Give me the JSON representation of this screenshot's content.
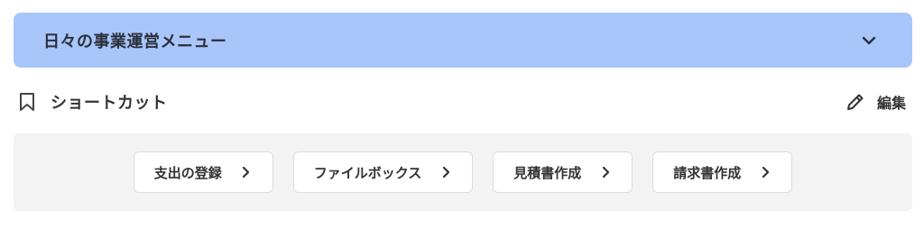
{
  "menu": {
    "title": "日々の事業運営メニュー",
    "toggle_icon": "chevron-down-icon",
    "background_color": "#a8c6fa"
  },
  "shortcuts": {
    "icon": "bookmark-icon",
    "title": "ショートカット",
    "edit": {
      "icon": "pencil-icon",
      "label": "編集"
    },
    "items": [
      {
        "label": "支出の登録",
        "icon": "chevron-right-icon"
      },
      {
        "label": "ファイルボックス",
        "icon": "chevron-right-icon"
      },
      {
        "label": "見積書作成",
        "icon": "chevron-right-icon"
      },
      {
        "label": "請求書作成",
        "icon": "chevron-right-icon"
      }
    ],
    "panel_color": "#f3f3f3"
  }
}
